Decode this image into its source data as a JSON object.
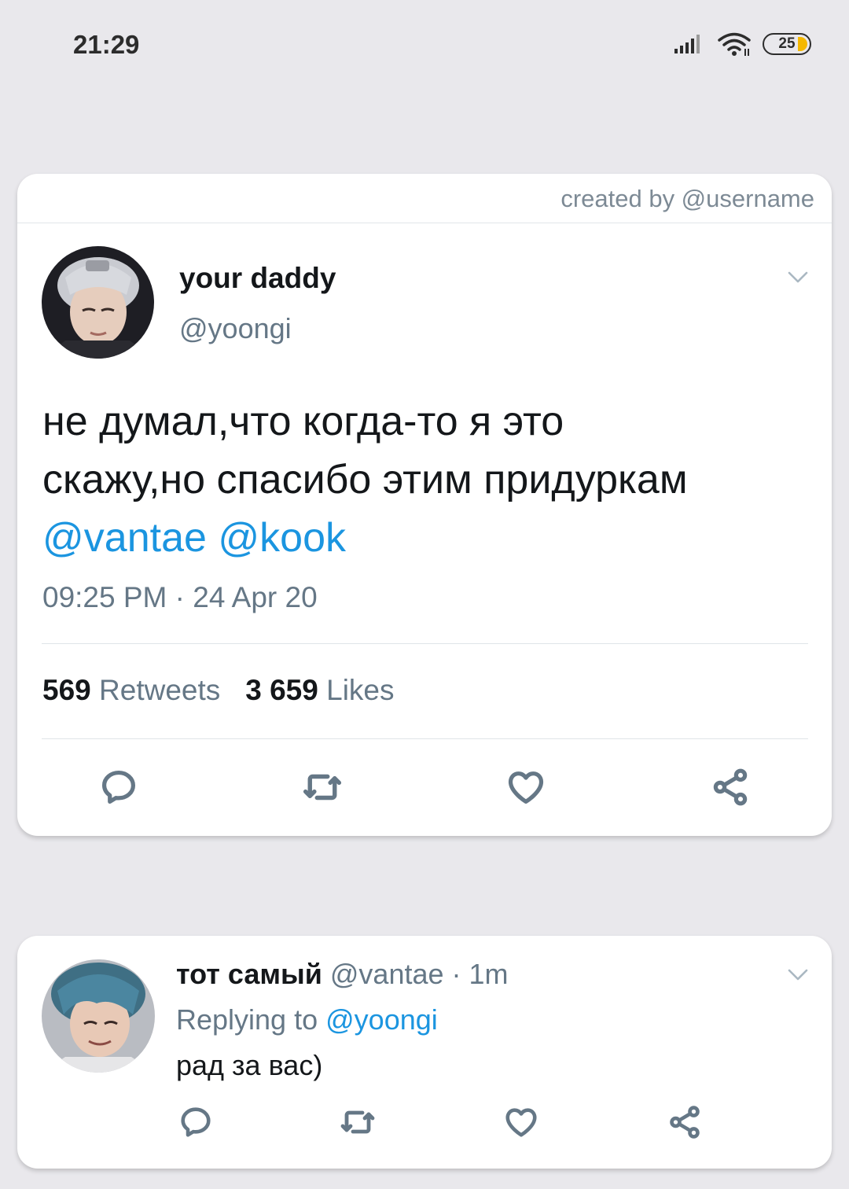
{
  "status_bar": {
    "time": "21:29",
    "battery": "25"
  },
  "tweet": {
    "credit": "created by @username",
    "display_name": "your daddy",
    "handle": "@yoongi",
    "text_line1": "не думал,что когда-то я это",
    "text_line2": "скажу,но спасибо этим придуркам",
    "mention1": "@vantae",
    "mention2": "@kook",
    "timestamp": "09:25 PM · 24 Apr 20",
    "retweets_count": "569",
    "retweets_label": "Retweets",
    "likes_count": "3 659",
    "likes_label": "Likes"
  },
  "reply": {
    "display_name": "тот самый",
    "handle": "@vantae",
    "time": "· 1m",
    "replying_label": "Replying to",
    "replying_to": "@yoongi",
    "text": "рад за вас)"
  },
  "icons": [
    "comment-icon",
    "retweet-icon",
    "heart-icon",
    "share-icon",
    "chevron-down-icon"
  ],
  "colors": {
    "accent": "#1b95e0",
    "muted": "#657786",
    "background": "#e9e8ec"
  }
}
